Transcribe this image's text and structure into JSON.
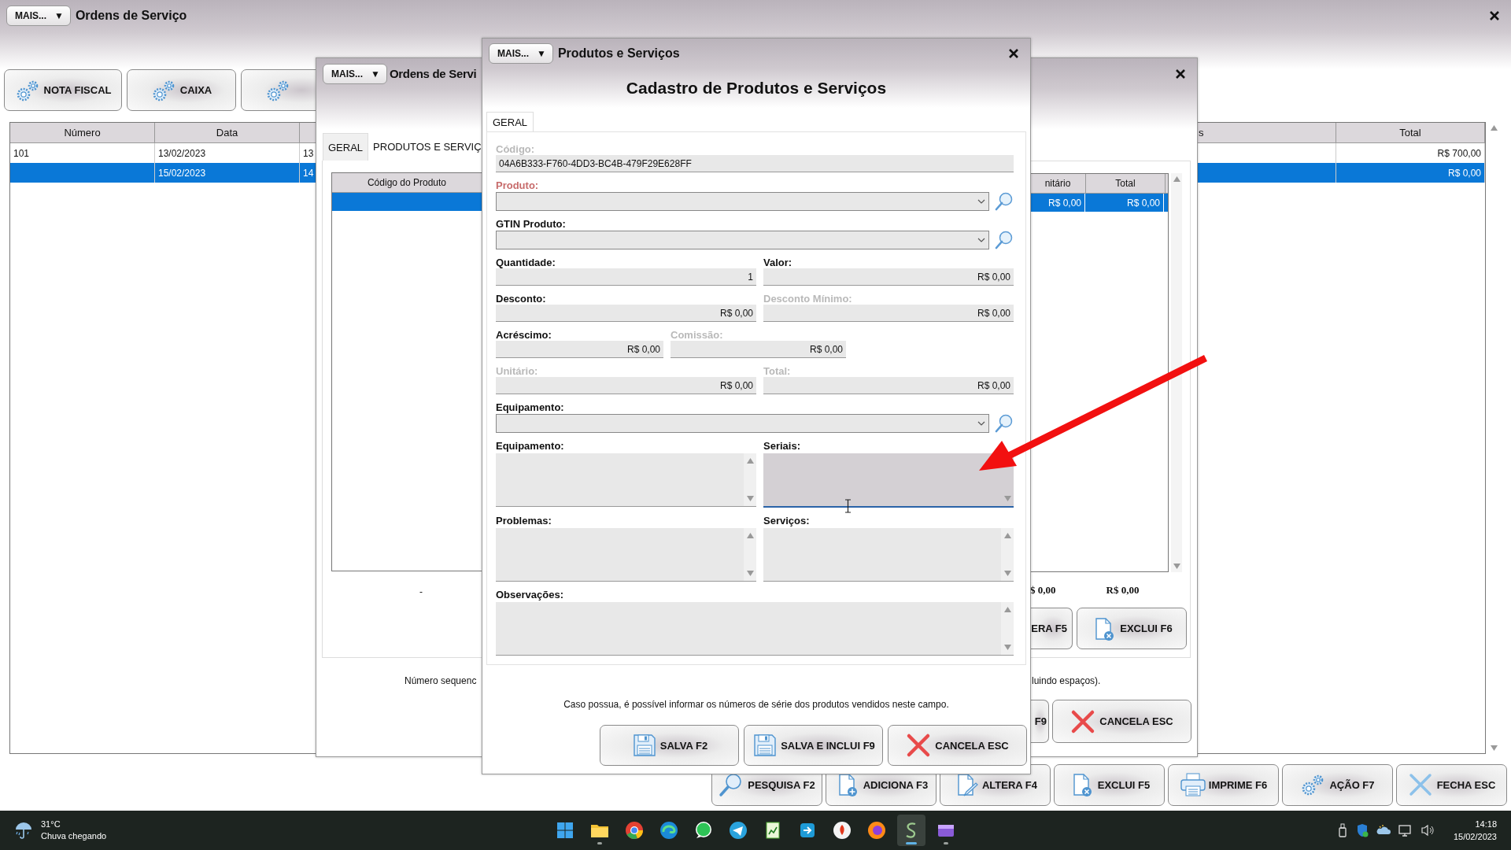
{
  "main_window": {
    "menu_button": {
      "label": "MAIS...",
      "arrow": "▼"
    },
    "title": "Ordens de Serviço",
    "toolbar": [
      {
        "label": "NOTA FISCAL",
        "kind": "gears"
      },
      {
        "label": "CAIXA",
        "kind": "gears"
      },
      {
        "kind": "gears"
      }
    ],
    "table": {
      "columns": [
        {
          "label": "Número"
        },
        {
          "label": "Data"
        },
        {},
        {
          "label": "s"
        },
        {
          "label": "Total"
        }
      ],
      "rows": [
        {
          "selected": false,
          "cells": [
            "101",
            "13/02/2023",
            "13",
            null,
            "R$ 700,00"
          ]
        },
        {
          "selected": true,
          "cells": [
            null,
            "15/02/2023",
            "14",
            null,
            "R$ 0,00"
          ]
        }
      ]
    },
    "bottom_toolbar": [
      {
        "label": "PESQUISA F2",
        "kind": "magnifier"
      },
      {
        "label": "ADICIONA F3",
        "kind": "doc-plus"
      },
      {
        "label": "ALTERA F4",
        "kind": "doc-pencil"
      },
      {
        "label": "EXCLUI F5",
        "kind": "doc-x"
      },
      {
        "label": "IMPRIME F6",
        "kind": "printer"
      },
      {
        "label": "AÇÃO F7",
        "kind": "gears"
      },
      {
        "label": "FECHA ESC",
        "kind": "x-blue"
      }
    ]
  },
  "orders_window": {
    "menu_button": {
      "label": "MAIS...",
      "arrow": "▼"
    },
    "title": "Ordens de Servi",
    "tabs": [
      {
        "label": "GERAL",
        "selected": false
      },
      {
        "label": "PRODUTOS E SERVIÇ",
        "selected": true
      }
    ],
    "grid": {
      "columns": [
        {
          "label": "Código do Produto"
        },
        {
          "label": "nitário"
        },
        {
          "label": "Total"
        }
      ],
      "rows": [
        {
          "selected": true,
          "cells": [
            null,
            "R$ 0,00",
            "R$ 0,00"
          ]
        }
      ]
    },
    "totals": {
      "dash": "-",
      "unitario": "$ 0,00",
      "total": "R$ 0,00"
    },
    "panel_buttons": [
      {
        "label": "ERA F5"
      },
      {
        "label": "EXCLUI F6",
        "kind": "doc-x"
      }
    ],
    "note": {
      "left": "Número sequenc",
      "right": "luindo espaços)."
    },
    "footer_buttons": [
      {
        "label": "F9"
      },
      {
        "label": "CANCELA ESC",
        "kind": "x-red"
      }
    ]
  },
  "product_dialog": {
    "menu_button": {
      "label": "MAIS...",
      "arrow": "▼"
    },
    "title": "Produtos e Serviços",
    "heading": "Cadastro de Produtos e Serviços",
    "tabs": [
      {
        "label": "GERAL",
        "selected": true
      }
    ],
    "rows": [
      {
        "kind": "full",
        "fields": [
          {
            "kind": "text",
            "label": "Código:",
            "value": "04A6B333-F760-4DD3-BC4B-479F29E628FF",
            "disabled": true,
            "required": false
          }
        ]
      },
      {
        "kind": "full",
        "fields": [
          {
            "kind": "combo",
            "label": "Produto:",
            "disabled": false,
            "required": true
          }
        ]
      },
      {
        "kind": "full",
        "fields": [
          {
            "kind": "combo",
            "label": "GTIN Produto:",
            "disabled": false,
            "required": false
          }
        ]
      },
      {
        "kind": "half",
        "fields": [
          {
            "kind": "number",
            "label": "Quantidade:",
            "value": "1",
            "disabled": false,
            "required": false
          },
          {
            "kind": "number",
            "label": "Valor:",
            "value": "R$ 0,00",
            "disabled": false,
            "required": false
          }
        ]
      },
      {
        "kind": "half",
        "fields": [
          {
            "kind": "number",
            "label": "Desconto:",
            "value": "R$ 0,00",
            "disabled": false,
            "required": false
          },
          {
            "kind": "number",
            "label": "Desconto Mínimo:",
            "value": "R$ 0,00",
            "disabled": true,
            "required": false
          }
        ]
      },
      {
        "kind": "third",
        "fields": [
          {
            "kind": "number",
            "label": "Acréscimo:",
            "value": "R$ 0,00",
            "disabled": false,
            "required": false
          },
          {
            "kind": "number",
            "label": "Comissão:",
            "value": "R$ 0,00",
            "disabled": true,
            "required": false
          }
        ]
      },
      {
        "kind": "half",
        "fields": [
          {
            "kind": "number",
            "label": "Unitário:",
            "value": "R$ 0,00",
            "disabled": true,
            "required": false
          },
          {
            "kind": "number",
            "label": "Total:",
            "value": "R$ 0,00",
            "disabled": true,
            "required": false
          }
        ]
      },
      {
        "kind": "full",
        "fields": [
          {
            "kind": "combo",
            "label": "Equipamento:",
            "disabled": false,
            "required": false
          }
        ]
      },
      {
        "kind": "half",
        "fields": [
          {
            "kind": "memo",
            "label": "Equipamento:",
            "disabled": false,
            "required": false,
            "focused": false
          },
          {
            "kind": "memo",
            "label": "Seriais:",
            "disabled": false,
            "required": false,
            "focused": true
          }
        ]
      },
      {
        "kind": "half",
        "fields": [
          {
            "kind": "memo",
            "label": "Problemas:",
            "disabled": false,
            "required": false,
            "focused": false
          },
          {
            "kind": "memo",
            "label": "Serviços:",
            "disabled": false,
            "required": false,
            "focused": false
          }
        ]
      },
      {
        "kind": "full",
        "fields": [
          {
            "kind": "memo",
            "label": "Observações:",
            "disabled": false,
            "required": false,
            "focused": false
          }
        ]
      }
    ],
    "help": "Caso possua, é possível informar os números de série dos produtos vendidos neste campo.",
    "buttons": [
      {
        "label": "SALVA F2",
        "kind": "floppy"
      },
      {
        "label": "SALVA E INCLUI F9",
        "kind": "floppy"
      },
      {
        "label": "CANCELA ESC",
        "kind": "x-red"
      }
    ]
  },
  "taskbar": {
    "weather": {
      "temperature": "31°C",
      "forecast": "Chuva chegando"
    },
    "apps": [
      {
        "kind": "start",
        "active": false,
        "running": false
      },
      {
        "kind": "folder",
        "active": false,
        "running": true
      },
      {
        "kind": "chrome",
        "active": false,
        "running": false
      },
      {
        "kind": "edge",
        "active": false,
        "running": false
      },
      {
        "kind": "whatsapp",
        "active": false,
        "running": false
      },
      {
        "kind": "telegram",
        "active": false,
        "running": false
      },
      {
        "kind": "sheet",
        "active": false,
        "running": false
      },
      {
        "kind": "blue-app",
        "active": false,
        "running": false
      },
      {
        "kind": "red-app",
        "active": false,
        "running": false
      },
      {
        "kind": "firefox",
        "active": false,
        "running": false
      },
      {
        "kind": "s-app",
        "active": true,
        "running": true
      },
      {
        "kind": "purple-app",
        "active": false,
        "running": true
      }
    ],
    "clock": {
      "time": "14:18",
      "date": "15/02/2023"
    }
  }
}
